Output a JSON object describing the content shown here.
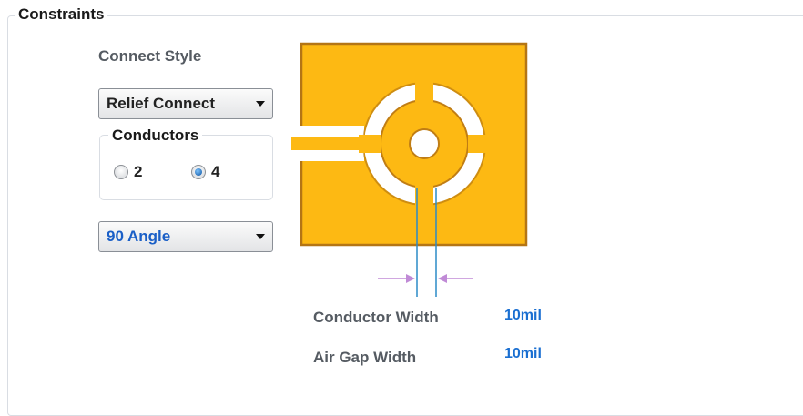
{
  "constraints": {
    "title": "Constraints",
    "connect_style_label": "Connect Style",
    "connect_style_value": "Relief Connect",
    "conductors": {
      "title": "Conductors",
      "options": [
        {
          "label": "2",
          "checked": false
        },
        {
          "label": "4",
          "checked": true
        }
      ]
    },
    "angle_value": "90 Angle",
    "conductor_width_label": "Conductor Width",
    "conductor_width_value": "10mil",
    "air_gap_width_label": "Air Gap Width",
    "air_gap_width_value": "10mil"
  },
  "colors": {
    "pad_fill": "#fdb913",
    "pad_edge": "#a86a11",
    "dimension_line": "#2b8bc7",
    "dimension_arrow": "#c08ad6",
    "value_text": "#1a6fd1",
    "angle_text": "#1a5fc7"
  }
}
